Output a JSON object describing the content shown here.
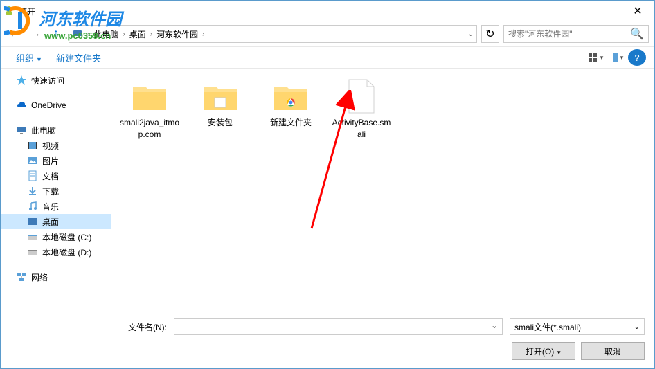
{
  "window": {
    "title": "打开",
    "close": "✕"
  },
  "watermark": {
    "text": "河东软件园",
    "url": "www.pc0359.cn"
  },
  "nav": {
    "back": "←",
    "forward": "→",
    "up": "↑",
    "refresh": "↻"
  },
  "breadcrumb": {
    "crumbs": [
      "此电脑",
      "桌面",
      "河东软件园"
    ],
    "dropdown": "⌄"
  },
  "search": {
    "placeholder": "搜索\"河东软件园\""
  },
  "toolbar": {
    "organize": "组织",
    "newfolder": "新建文件夹",
    "help": "?"
  },
  "sidebar": {
    "quick": "快速访问",
    "onedrive": "OneDrive",
    "thispc": "此电脑",
    "video": "视频",
    "pictures": "图片",
    "documents": "文档",
    "downloads": "下载",
    "music": "音乐",
    "desktop": "桌面",
    "diskc": "本地磁盘 (C:)",
    "diskd": "本地磁盘 (D:)",
    "network": "网络"
  },
  "files": [
    {
      "name": "smali2java_itmop.com",
      "type": "folder"
    },
    {
      "name": "安装包",
      "type": "folder-exe"
    },
    {
      "name": "新建文件夹",
      "type": "folder-chrome"
    },
    {
      "name": "ActivityBase.smali",
      "type": "file"
    }
  ],
  "footer": {
    "filename_label": "文件名(N):",
    "filename_value": "",
    "filter": "smali文件(*.smali)",
    "open": "打开(O)",
    "cancel": "取消"
  }
}
